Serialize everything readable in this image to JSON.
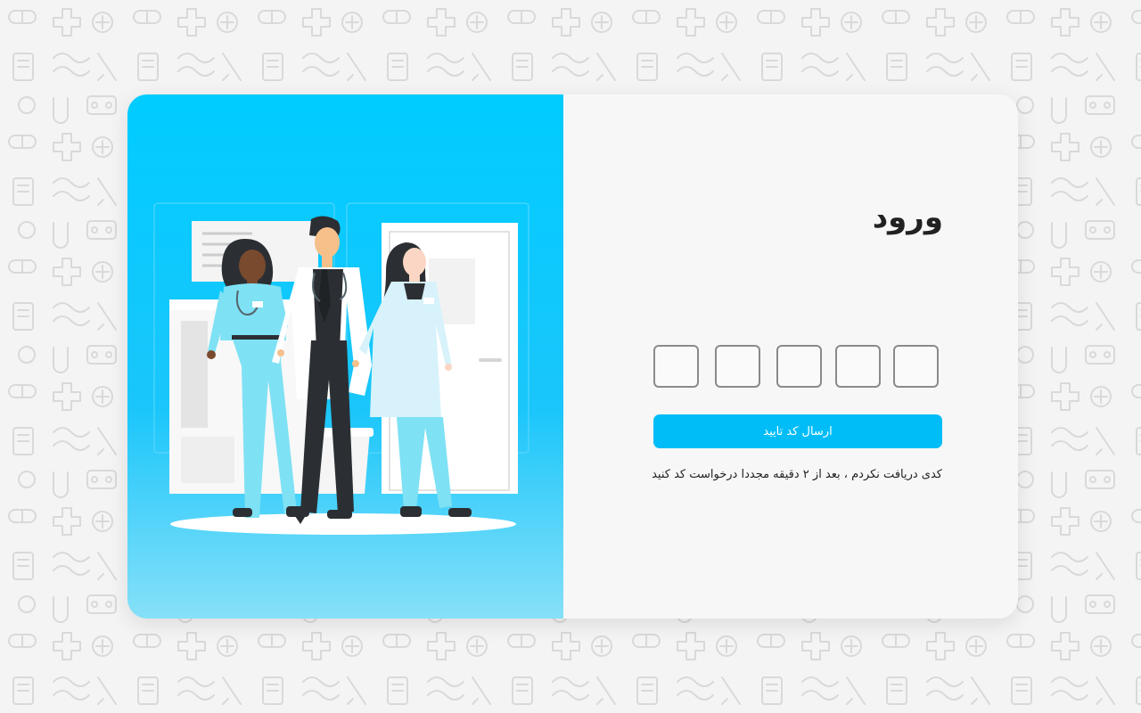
{
  "login": {
    "title": "ورود",
    "otp_boxes": [
      "",
      "",
      "",
      "",
      ""
    ],
    "submit_label": "ارسال کد تایید",
    "resend_note": "کدی دریافت نکردم ، بعد از ۲ دقیقه مجددا درخواست کد کنید"
  },
  "colors": {
    "accent": "#00bdf8",
    "panel_gradient_top": "#00ccff",
    "panel_gradient_bottom": "#86e0f8"
  },
  "illustration": {
    "icon": "medical-team-illustration"
  }
}
